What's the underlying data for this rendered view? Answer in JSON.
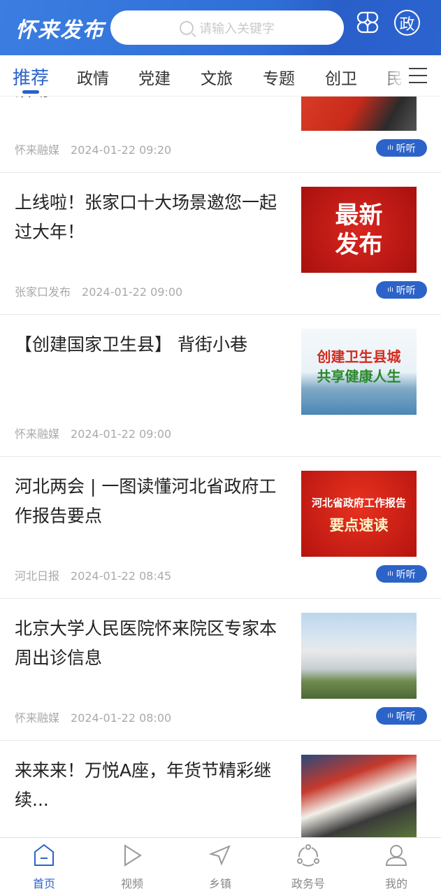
{
  "header": {
    "logo": "怀来发布",
    "search_placeholder": "请输入关键字",
    "gov_badge": "政",
    "accent": "#2c63c9"
  },
  "tabs": [
    {
      "label": "推荐",
      "active": true
    },
    {
      "label": "政情"
    },
    {
      "label": "党建"
    },
    {
      "label": "文旅"
    },
    {
      "label": "专题"
    },
    {
      "label": "创卫"
    },
    {
      "label": "民"
    }
  ],
  "listen_label": "听听",
  "articles": [
    {
      "title": "活动",
      "source": "怀来融媒",
      "time": "2024-01-22 09:20",
      "listen": true
    },
    {
      "title": "上线啦！张家口十大场景邀您一起过大年！",
      "source": "张家口发布",
      "time": "2024-01-22 09:00",
      "listen": true,
      "thumb_text": [
        "最新",
        "发布"
      ]
    },
    {
      "title": "【创建国家卫生县】 背街小巷",
      "source": "怀来融媒",
      "time": "2024-01-22 09:00",
      "listen": false,
      "thumb_text": [
        "创建卫生县城",
        "共享健康人生"
      ]
    },
    {
      "title": "河北两会 | 一图读懂河北省政府工作报告要点",
      "source": "河北日报",
      "time": "2024-01-22 08:45",
      "listen": true,
      "thumb_text": [
        "河北省政府工作报告",
        "要点速读"
      ]
    },
    {
      "title": "北京大学人民医院怀来院区专家本周出诊信息",
      "source": "怀来融媒",
      "time": "2024-01-22 08:00",
      "listen": true
    },
    {
      "title": "来来来！万悦A座，年货节精彩继续...",
      "source": "",
      "time": "",
      "listen": false
    }
  ],
  "bottom_nav": [
    {
      "label": "首页",
      "icon": "home-icon",
      "active": true
    },
    {
      "label": "视频",
      "icon": "play-icon"
    },
    {
      "label": "乡镇",
      "icon": "navigation-icon"
    },
    {
      "label": "政务号",
      "icon": "network-icon"
    },
    {
      "label": "我的",
      "icon": "user-icon"
    }
  ]
}
